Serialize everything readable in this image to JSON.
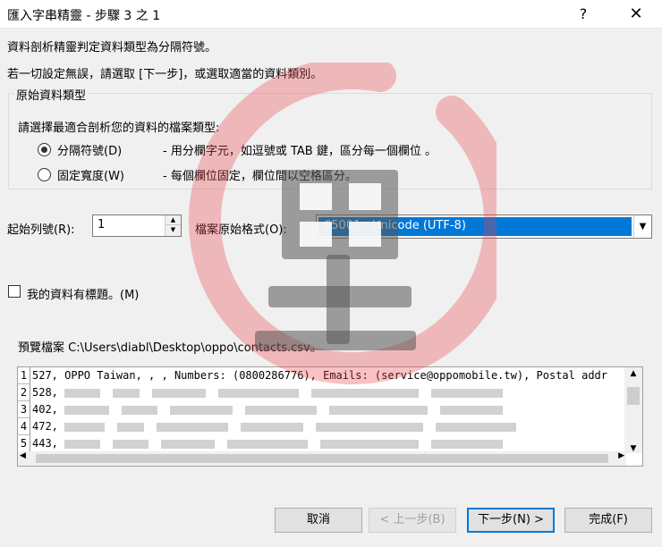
{
  "window": {
    "title": "匯入字串精靈 - 步驟 3 之 1",
    "help": "?",
    "close": "✕"
  },
  "intro": {
    "line1": "資料剖析精靈判定資料類型為分隔符號。",
    "line2": "若一切設定無誤，請選取 [下一步]，或選取適當的資料類別。"
  },
  "group": {
    "legend": "原始資料類型",
    "prompt": "請選擇最適合剖析您的資料的檔案類型:",
    "options": [
      {
        "label": "分隔符號(D)",
        "desc": "- 用分欄字元，如逗號或 TAB 鍵，區分每一個欄位 。",
        "checked": true
      },
      {
        "label": "固定寬度(W)",
        "desc": "- 每個欄位固定，欄位間以空格區分。",
        "checked": false
      }
    ]
  },
  "start_row": {
    "label": "起始列號(R):",
    "value": "1"
  },
  "origin": {
    "label": "檔案原始格式(O):",
    "value": "65001 : Unicode (UTF-8)"
  },
  "header_check": {
    "label": "我的資料有標題。(M)"
  },
  "preview": {
    "label": "預覽檔案 C:\\Users\\diabl\\Desktop\\oppo\\contacts.csv。",
    "row_numbers": [
      "1",
      "2",
      "3",
      "4",
      "5"
    ],
    "rows": [
      "527, OPPO Taiwan, , , Numbers: (0800286776), Emails: (service@oppomobile.tw), Postal addr",
      "528,",
      "402,",
      "472,",
      "443,"
    ]
  },
  "buttons": {
    "cancel": "取消",
    "back": "< 上一步(B)",
    "next": "下一步(N) >",
    "finish": "完成(F)"
  },
  "colors": {
    "accent": "#0078d7",
    "watermark": "#e8414a"
  },
  "icons": {
    "watermark": "red-circle-stamp-icon"
  }
}
